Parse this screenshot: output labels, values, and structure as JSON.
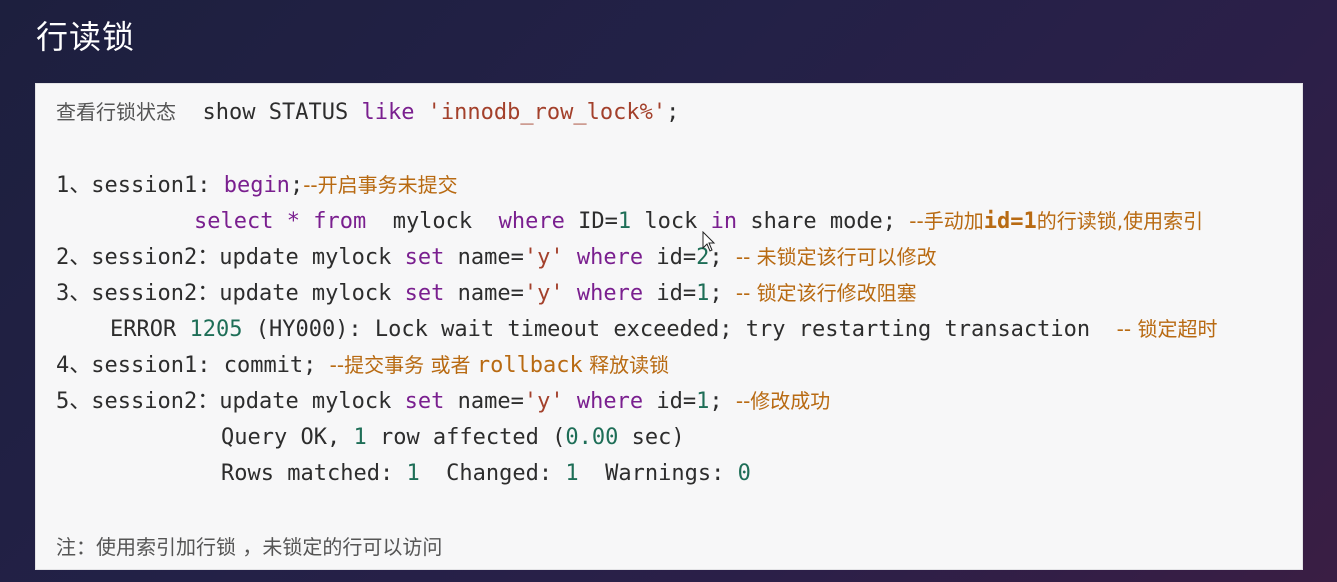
{
  "title": "行读锁",
  "colors": {
    "keyword": "#7a1f8f",
    "number": "#1e6e57",
    "string": "#a3402b",
    "comment": "#b86a12",
    "text": "#2d2d2d",
    "panel_bg": "#f7f7f8"
  },
  "lines": {
    "l0": {
      "label": "查看行锁状态",
      "code_a": "show STATUS ",
      "kw": "like",
      "str": " 'innodb_row_lock%'",
      "end": ";"
    },
    "l1": {
      "prefix": "1、session1: ",
      "kw": "begin",
      "end": ";",
      "comment": "--开启事务未提交"
    },
    "l2": {
      "a": "select * ",
      "kw1": "from",
      "b": "  mylock  ",
      "kw2": "where",
      "c": " ID=",
      "n1": "1",
      "d": " lock ",
      "kw3": "in",
      "e": " share mode; ",
      "comment_a": "--手动加",
      "comment_b": "id=1",
      "comment_c": "的行读锁,使用索引"
    },
    "l3": {
      "prefix": "2、session2：",
      "a": "update mylock ",
      "kw1": "set",
      "b": " name=",
      "str": "'y'",
      "sp": " ",
      "kw2": "where",
      "c": " id=",
      "n": "2",
      "end": "; ",
      "comment": "-- 未锁定该行可以修改"
    },
    "l4": {
      "prefix": "3、session2：",
      "a": "update mylock ",
      "kw1": "set",
      "b": " name=",
      "str": "'y'",
      "sp": " ",
      "kw2": "where",
      "c": " id=",
      "n": "1",
      "end": "; ",
      "comment": "-- 锁定该行修改阻塞"
    },
    "l5": {
      "a": "ERROR ",
      "n": "1205",
      "b": " (HY000): Lock wait timeout exceeded; try restarting transaction  ",
      "comment": "-- 锁定超时"
    },
    "l6": {
      "prefix": "4、session1: ",
      "a": "commit; ",
      "comment_a": "--提交事务 或者 ",
      "comment_b": "rollback",
      "comment_c": " 释放读锁"
    },
    "l7": {
      "prefix": "5、session2：",
      "a": "update mylock ",
      "kw1": "set",
      "b": " name=",
      "str": "'y'",
      "sp": " ",
      "kw2": "where",
      "c": " id=",
      "n": "1",
      "end": "; ",
      "comment": "--修改成功"
    },
    "l8": {
      "a": "Query OK, ",
      "n1": "1",
      "b": " row affected (",
      "n2": "0.00",
      "c": " sec)"
    },
    "l9": {
      "a": "Rows matched: ",
      "n1": "1",
      "b": "  Changed: ",
      "n2": "1",
      "c": "  Warnings: ",
      "n3": "0"
    },
    "note": "注：使用索引加行锁 ，未锁定的行可以访问"
  }
}
